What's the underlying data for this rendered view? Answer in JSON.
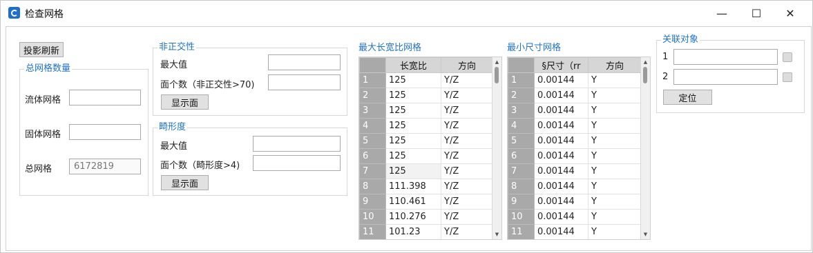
{
  "window": {
    "title": "检查网格",
    "minimize": "—",
    "maximize": "☐",
    "close": "✕"
  },
  "left": {
    "refresh_button": "投影刷新",
    "group_title": "总网格数量",
    "fluid_label": "流体网格",
    "fluid_value": "",
    "solid_label": "固体网格",
    "solid_value": "",
    "total_label": "总网格",
    "total_value": "6172819"
  },
  "nonortho": {
    "group_title": "非正交性",
    "max_label": "最大值",
    "max_value": "",
    "count_label": "面个数（非正交性>70)",
    "count_value": "",
    "show_button": "显示面"
  },
  "skew": {
    "group_title": "畸形度",
    "max_label": "最大值",
    "max_value": "",
    "count_label": "面个数（畸形度>4)",
    "count_value": "",
    "show_button": "显示面"
  },
  "aspect_grid": {
    "title": "最大长宽比网格",
    "headers": [
      "",
      "长宽比",
      "方向"
    ],
    "rows": [
      [
        "1",
        "125",
        "Y/Z"
      ],
      [
        "2",
        "125",
        "Y/Z"
      ],
      [
        "3",
        "125",
        "Y/Z"
      ],
      [
        "4",
        "125",
        "Y/Z"
      ],
      [
        "5",
        "125",
        "Y/Z"
      ],
      [
        "6",
        "125",
        "Y/Z"
      ],
      [
        "7",
        "125",
        "Y/Z"
      ],
      [
        "8",
        "111.398",
        "Y/Z"
      ],
      [
        "9",
        "110.461",
        "Y/Z"
      ],
      [
        "10",
        "110.276",
        "Y/Z"
      ]
    ],
    "partial_row": [
      "11",
      "101.23",
      "Y/Z"
    ]
  },
  "size_grid": {
    "title": "最小尺寸网格",
    "headers": [
      "",
      "§尺寸（rr",
      "方向"
    ],
    "rows": [
      [
        "1",
        "0.00144",
        "Y"
      ],
      [
        "2",
        "0.00144",
        "Y"
      ],
      [
        "3",
        "0.00144",
        "Y"
      ],
      [
        "4",
        "0.00144",
        "Y"
      ],
      [
        "5",
        "0.00144",
        "Y"
      ],
      [
        "6",
        "0.00144",
        "Y"
      ],
      [
        "7",
        "0.00144",
        "Y"
      ],
      [
        "8",
        "0.00144",
        "Y"
      ],
      [
        "9",
        "0.00144",
        "Y"
      ],
      [
        "10",
        "0.00144",
        "Y"
      ]
    ],
    "partial_row": [
      "11",
      "0.00144",
      "Y"
    ]
  },
  "related": {
    "group_title": "关联对象",
    "item1_label": "1",
    "item1_value": "",
    "item2_label": "2",
    "item2_value": "",
    "locate_button": "定位"
  }
}
